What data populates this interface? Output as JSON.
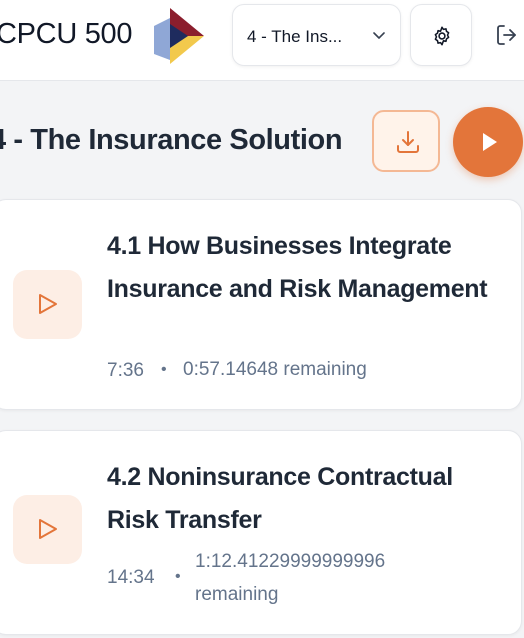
{
  "header": {
    "app_title": "CPCU 500",
    "course_select": {
      "value": "4 - The Ins..."
    },
    "icons": {
      "logo": "course-logo",
      "chevron": "chevron-down-icon",
      "settings": "gear-icon",
      "logout": "logout-icon"
    }
  },
  "section": {
    "title": "4 - The Insurance Solution",
    "icons": {
      "download": "download-icon",
      "play_all": "play-icon"
    }
  },
  "lessons": [
    {
      "title": "4.1 How Businesses Integrate Insurance and Risk Management",
      "duration": "7:36",
      "separator": "•",
      "remaining": "0:57.14648 remaining"
    },
    {
      "title": "4.2 Noninsurance Contractual Risk Transfer",
      "duration": "14:34",
      "separator": "•",
      "remaining": "1:12.41229999999996 remaining"
    }
  ],
  "colors": {
    "accent": "#e3753a",
    "accent_light": "#fdeee5",
    "download_border": "#f4b894",
    "muted_text": "#64748b",
    "logo_navy": "#1e2b5e",
    "logo_red": "#8b1e2d",
    "logo_yellow": "#f2c94c",
    "logo_blue": "#8fa7d6"
  }
}
